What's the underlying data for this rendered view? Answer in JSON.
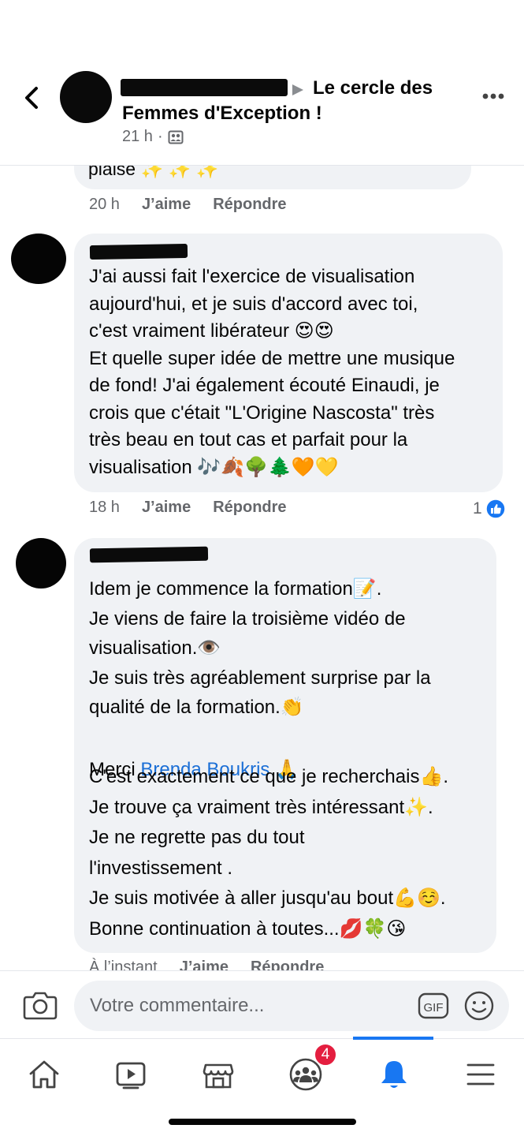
{
  "header": {
    "group_name_line1": "Le cercle des",
    "group_name_line2": "Femmes d'Exception !",
    "time": "21 h",
    "separator": "·",
    "icons": {
      "back": "chevron-left-icon",
      "audience": "group-audience-icon",
      "more": "more-dots-icon",
      "arrow": "triangle-right-icon"
    }
  },
  "comments": [
    {
      "text": "plaise ✨ ✨ ✨",
      "time": "20 h",
      "like_label": "J’aime",
      "reply_label": "Répondre"
    },
    {
      "text": "J'ai aussi fait l'exercice de visualisation\naujourd'hui, et je suis d'accord avec toi,\nc'est vraiment libérateur 😍😍\nEt quelle super idée de mettre une musique\nde fond! J'ai également écouté Einaudi, je\ncrois que c'était \"L'Origine Nascosta\" très\ntrès beau en tout cas et parfait pour la\nvisualisation 🎶🍂🌳🌲🧡💛",
      "time": "18 h",
      "like_label": "J’aime",
      "reply_label": "Répondre",
      "reaction_count": "1",
      "reaction_icon": "thumbs-up-icon"
    },
    {
      "lines_before": "Idem je commence la formation📝.\nJe viens de faire la troisième vidéo de\nvisualisation.👁️\n Je suis très agréablement surprise par la\nqualité de la formation.👏",
      "merci": "Merci ",
      "mention": "Brenda Boukris",
      "merci_suffix": " 🙏",
      "lines_after": "C'est exactement ce que je recherchais👍.\nJe trouve ça vraiment très intéressant✨.\n Je ne regrette pas du tout\nl'investissement .\nJe suis motivée à aller jusqu'au bout💪☺️.\nBonne continuation à toutes...💋🍀😘",
      "time": "À l’instant",
      "like_label": "J’aime",
      "reply_label": "Répondre"
    }
  ],
  "composer": {
    "placeholder": "Votre commentaire...",
    "gif_label": "GIF",
    "icons": {
      "camera": "camera-icon",
      "emoji": "emoji-icon"
    }
  },
  "navbar": {
    "items": [
      "home-icon",
      "video-icon",
      "marketplace-icon",
      "groups-icon",
      "notifications-icon",
      "menu-icon"
    ],
    "active": "notifications-icon",
    "groups_badge": "4",
    "accent": "#1877f2",
    "badge_color": "#e41e3f"
  }
}
